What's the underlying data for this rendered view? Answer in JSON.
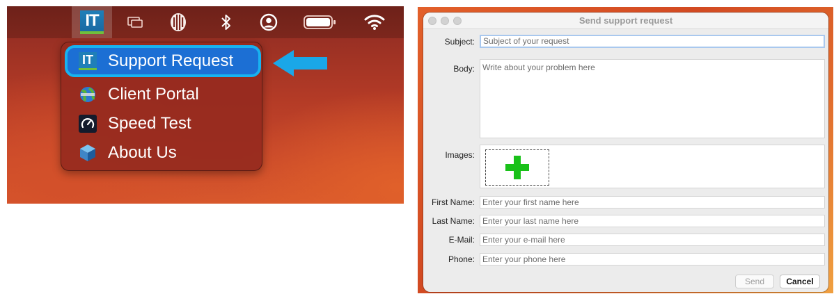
{
  "menubar": {
    "app_icon_text": "IT",
    "icons": [
      "display-switch-icon",
      "audio-levels-icon",
      "bluetooth-icon",
      "user-account-icon",
      "battery-icon",
      "wifi-icon"
    ]
  },
  "dropdown": {
    "items": [
      {
        "label": "Support Request",
        "icon": "it-logo-icon",
        "selected": true
      },
      {
        "label": "Client Portal",
        "icon": "globe-icon",
        "selected": false
      },
      {
        "label": "Speed Test",
        "icon": "speedometer-icon",
        "selected": false
      },
      {
        "label": "About Us",
        "icon": "cube-icon",
        "selected": false
      }
    ],
    "mini_it_text": "IT"
  },
  "colors": {
    "selection_blue": "#1c6fd4",
    "selection_outline": "#18b2f0",
    "arrow_blue": "#1aa7e8",
    "plus_green": "#19c119"
  },
  "window": {
    "title": "Send support request",
    "fields": {
      "subject": {
        "label": "Subject:",
        "placeholder": "Subject of your request"
      },
      "body": {
        "label": "Body:",
        "placeholder": "Write about your problem here"
      },
      "images": {
        "label": "Images:"
      },
      "first_name": {
        "label": "First Name:",
        "placeholder": "Enter your first name here"
      },
      "last_name": {
        "label": "Last Name:",
        "placeholder": "Enter your last name here"
      },
      "email": {
        "label": "E-Mail:",
        "placeholder": "Enter your e-mail here"
      },
      "phone": {
        "label": "Phone:",
        "placeholder": "Enter your phone here"
      }
    },
    "buttons": {
      "send": "Send",
      "cancel": "Cancel"
    }
  }
}
